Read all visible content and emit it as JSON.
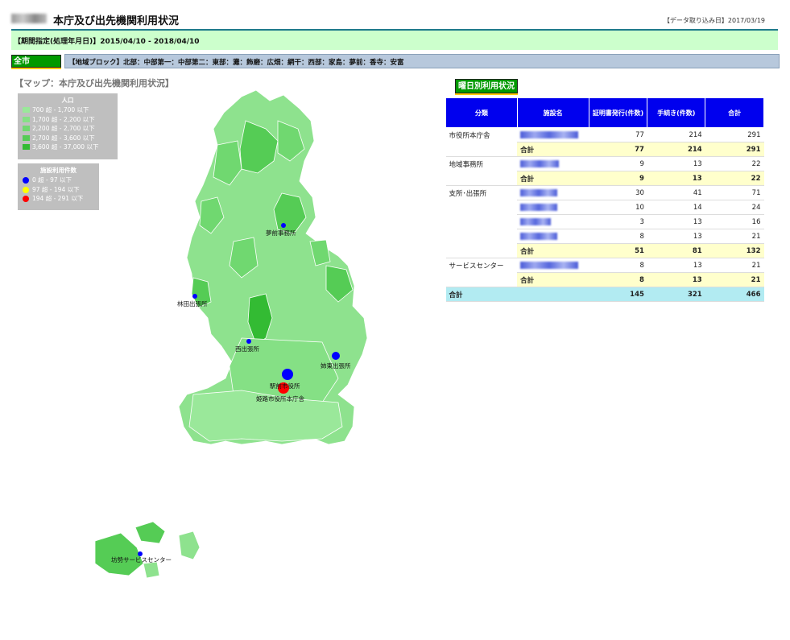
{
  "header": {
    "title": "本庁及び出先機関利用状況",
    "import_date": "【データ取り込み日】2017/03/19"
  },
  "period": {
    "text": "【期間指定(処理年月日)】2015/04/10 - 2018/04/10"
  },
  "whole_city_button": "全市",
  "region_block": {
    "text": "【地域ブロック】北部：中部第一：中部第二：東部：灘：飾磨：広畑：網干：西部：家島：夢前：香寺：安富"
  },
  "map": {
    "title": "【マップ：本庁及び出先機関利用状況】",
    "population_legend": {
      "title": "人口",
      "items": [
        {
          "label": "700 超 - 1,700 以下",
          "color": "#9ae89a"
        },
        {
          "label": "1,700 超 - 2,200 以下",
          "color": "#85e085"
        },
        {
          "label": "2,200 超 - 2,700 以下",
          "color": "#70d870"
        },
        {
          "label": "2,700 超 - 3,600 以下",
          "color": "#55cc55"
        },
        {
          "label": "3,600 超 - 37,000 以下",
          "color": "#33bb33"
        }
      ]
    },
    "facility_legend": {
      "title": "施設利用件数",
      "items": [
        {
          "label": "0 超 - 97 以下",
          "color": "#0000ff"
        },
        {
          "label": "97 超 - 194 以下",
          "color": "#ffff00"
        },
        {
          "label": "194 超 - 291 以下",
          "color": "#ff0000"
        }
      ]
    },
    "labels": {
      "yumesaki": "夢前事務所",
      "hayashida": "林田出張所",
      "nishi": "西出張所",
      "shikito": "姉東出張所",
      "ekimae": "駅前市役所",
      "honcho": "姫路市役所本庁舎",
      "ieshima": "坊勢サービスセンター"
    }
  },
  "weekday_button": "曜日別利用状況",
  "table": {
    "headers": [
      "分類",
      "施設名",
      "証明書発行(件数)",
      "手続き(件数)",
      "合計"
    ],
    "groups": [
      {
        "category": "市役所本庁舎",
        "rows": [
          {
            "a": "77",
            "b": "214",
            "c": "291"
          }
        ],
        "subtotal_label": "合計",
        "subtotal": {
          "a": "77",
          "b": "214",
          "c": "291"
        }
      },
      {
        "category": "地域事務所",
        "rows": [
          {
            "a": "9",
            "b": "13",
            "c": "22"
          }
        ],
        "subtotal_label": "合計",
        "subtotal": {
          "a": "9",
          "b": "13",
          "c": "22"
        }
      },
      {
        "category": "支所･出張所",
        "rows": [
          {
            "a": "30",
            "b": "41",
            "c": "71"
          },
          {
            "a": "10",
            "b": "14",
            "c": "24"
          },
          {
            "a": "3",
            "b": "13",
            "c": "16"
          },
          {
            "a": "8",
            "b": "13",
            "c": "21"
          }
        ],
        "subtotal_label": "合計",
        "subtotal": {
          "a": "51",
          "b": "81",
          "c": "132"
        }
      },
      {
        "category": "サービスセンター",
        "rows": [
          {
            "a": "8",
            "b": "13",
            "c": "21"
          }
        ],
        "subtotal_label": "合計",
        "subtotal": {
          "a": "8",
          "b": "13",
          "c": "21"
        }
      }
    ],
    "grand_total": {
      "label": "合計",
      "a": "145",
      "b": "321",
      "c": "466"
    }
  }
}
